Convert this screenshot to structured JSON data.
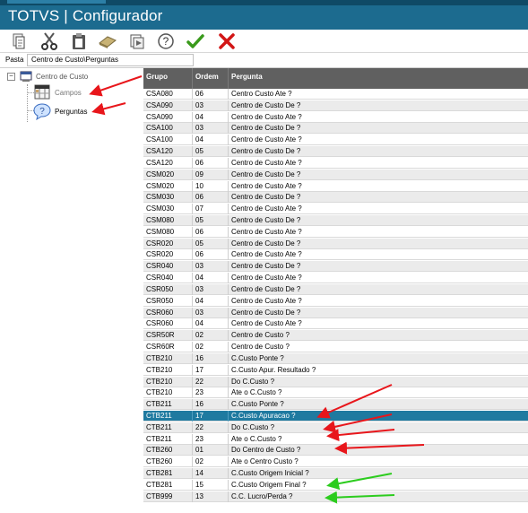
{
  "app": {
    "title": "TOTVS | Configurador"
  },
  "toolbar": {
    "icons": [
      "copy-icon",
      "cut-icon",
      "paste-icon",
      "eraser-icon",
      "export-icon",
      "help-icon",
      "confirm-icon",
      "cancel-icon"
    ]
  },
  "path": {
    "label": "Pasta",
    "value": "Centro de Custo\\Perguntas"
  },
  "tree": {
    "root": "Centro de Custo",
    "children": [
      "Campos",
      "Perguntas"
    ]
  },
  "grid": {
    "headers": [
      "Grupo",
      "Ordem",
      "Pergunta"
    ],
    "selected_row": 14,
    "rows": [
      [
        "CSA080",
        "06",
        "Centro Custo Ate ?"
      ],
      [
        "CSA090",
        "03",
        "Centro de Custo De ?"
      ],
      [
        "CSA090",
        "04",
        "Centro de Custo Ate ?"
      ],
      [
        "CSA100",
        "03",
        "Centro de Custo De ?"
      ],
      [
        "CSA100",
        "04",
        "Centro de Custo Ate ?"
      ],
      [
        "CSA120",
        "05",
        "Centro de Custo De ?"
      ],
      [
        "CSA120",
        "06",
        "Centro de Custo Ate ?"
      ],
      [
        "CSM020",
        "09",
        "Centro de Custo De ?"
      ],
      [
        "CSM020",
        "10",
        "Centro de Custo Ate ?"
      ],
      [
        "CSM030",
        "06",
        "Centro de Custo De ?"
      ],
      [
        "CSM030",
        "07",
        "Centro de Custo Ate ?"
      ],
      [
        "CSM080",
        "05",
        "Centro de Custo De ?"
      ],
      [
        "CSM080",
        "06",
        "Centro de Custo Ate ?"
      ],
      [
        "CSR020",
        "05",
        "Centro de Custo De ?"
      ],
      [
        "CSR020",
        "06",
        "Centro de Custo Ate ?"
      ],
      [
        "CSR040",
        "03",
        "Centro de Custo De ?"
      ],
      [
        "CSR040",
        "04",
        "Centro de Custo Ate ?"
      ],
      [
        "CSR050",
        "03",
        "Centro de Custo De ?"
      ],
      [
        "CSR050",
        "04",
        "Centro de Custo Ate ?"
      ],
      [
        "CSR060",
        "03",
        "Centro de Custo De ?"
      ],
      [
        "CSR060",
        "04",
        "Centro de Custo Ate ?"
      ],
      [
        "CSR50R",
        "02",
        "Centro de Custo ?"
      ],
      [
        "CSR60R",
        "02",
        "Centro de Custo ?"
      ],
      [
        "CTB210",
        "16",
        "C.Custo Ponte ?"
      ],
      [
        "CTB210",
        "17",
        "C.Custo Apur. Resultado ?"
      ],
      [
        "CTB210",
        "22",
        "Do C.Custo ?"
      ],
      [
        "CTB210",
        "23",
        "Ate o C.Custo ?"
      ],
      [
        "CTB211",
        "16",
        "C.Custo Ponte ?"
      ],
      [
        "CTB211",
        "17",
        "C.Custo Apuracao ?"
      ],
      [
        "CTB211",
        "22",
        "Do C.Custo ?"
      ],
      [
        "CTB211",
        "23",
        "Ate o C.Custo ?"
      ],
      [
        "CTB260",
        "01",
        "Do Centro de Custo ?"
      ],
      [
        "CTB260",
        "02",
        "Ate o Centro Custo ?"
      ],
      [
        "CTB281",
        "14",
        "C.Custo Origem Inicial ?"
      ],
      [
        "CTB281",
        "15",
        "C.Custo Origem Final ?"
      ],
      [
        "CTB999",
        "13",
        "C.C. Lucro/Perda ?"
      ]
    ]
  },
  "colors": {
    "title_bar": "#1c6b8f",
    "header_bg": "#606060",
    "selected_row": "#1f7aa0",
    "red_arrow": "#e8161b",
    "green_arrow": "#2ccc1e"
  }
}
